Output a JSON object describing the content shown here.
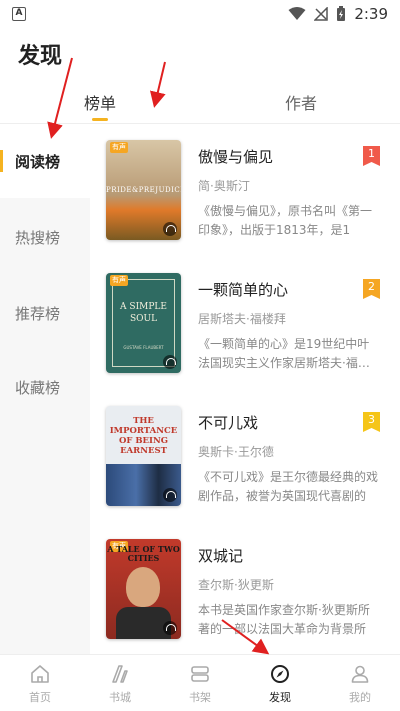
{
  "status_bar": {
    "app_icon_letter": "A",
    "time": "2:39"
  },
  "header": {
    "title": "发现"
  },
  "tabs": [
    {
      "label": "榜单",
      "active": true
    },
    {
      "label": "作者",
      "active": false
    }
  ],
  "sidebar": {
    "items": [
      {
        "label": "阅读榜",
        "active": true
      },
      {
        "label": "热搜榜",
        "active": false
      },
      {
        "label": "推荐榜",
        "active": false
      },
      {
        "label": "收藏榜",
        "active": false
      }
    ]
  },
  "books": [
    {
      "title": "傲慢与偏见",
      "author": "简·奥斯汀",
      "description": "《傲慢与偏见》，原书名叫《第一印象》，出版于1813年，是1",
      "rank": "1",
      "rank_color": "#f05a4a",
      "cover_text": "PRIDE&PREJUDICE",
      "cover_badge": "有声"
    },
    {
      "title": "一颗简单的心",
      "author": "居斯塔夫·福楼拜",
      "description": "《一颗简单的心》是19世纪中叶法国现实主义作家居斯塔夫·福楼拜",
      "rank": "2",
      "rank_color": "#f5a623",
      "cover_text": "A SIMPLE SOUL",
      "cover_author": "GUSTAVE FLAUBERT",
      "cover_badge": "有声"
    },
    {
      "title": "不可儿戏",
      "author": "奥斯卡·王尔德",
      "description": "《不可儿戏》是王尔德最经典的戏剧作品，被誉为英国现代喜剧的",
      "rank": "3",
      "rank_color": "#f5c518",
      "cover_text": "THE IMPORTANCE OF BEING EARNEST"
    },
    {
      "title": "双城记",
      "author": "查尔斯·狄更斯",
      "description": "本书是英国作家查尔斯·狄更斯所著的一部以法国大革命为背景所",
      "cover_text": "A TALE OF TWO CITIES",
      "cover_badge": "有声"
    }
  ],
  "bottom_nav": [
    {
      "label": "首页",
      "icon": "home-icon",
      "active": false
    },
    {
      "label": "书城",
      "icon": "bookstore-icon",
      "active": false
    },
    {
      "label": "书架",
      "icon": "bookshelf-icon",
      "active": false
    },
    {
      "label": "发现",
      "icon": "compass-icon",
      "active": true
    },
    {
      "label": "我的",
      "icon": "profile-icon",
      "active": false
    }
  ],
  "colors": {
    "accent": "#f5b320",
    "annotation_arrow": "#e02020"
  }
}
